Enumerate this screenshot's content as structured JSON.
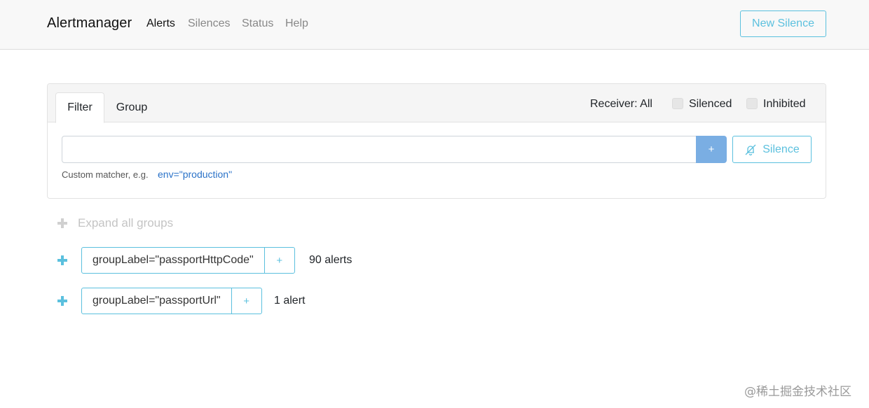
{
  "navbar": {
    "brand": "Alertmanager",
    "links": [
      "Alerts",
      "Silences",
      "Status",
      "Help"
    ],
    "new_silence_label": "New Silence"
  },
  "filter_card": {
    "tabs": [
      "Filter",
      "Group"
    ],
    "receiver_label": "Receiver: All",
    "silenced_label": "Silenced",
    "inhibited_label": "Inhibited",
    "filter_value": "",
    "add_label": "+",
    "silence_button_label": "Silence",
    "hint_text": "Custom matcher, e.g.",
    "hint_example": "env=\"production\""
  },
  "groups": {
    "expand_all_label": "Expand all groups",
    "items": [
      {
        "label": "groupLabel=\"passportHttpCode\"",
        "add": "+",
        "count": "90 alerts"
      },
      {
        "label": "groupLabel=\"passportUrl\"",
        "add": "+",
        "count": "1 alert"
      }
    ]
  },
  "watermark": "@稀土掘金技术社区",
  "colors": {
    "accent": "#5bc0de",
    "primary": "#7aaee3",
    "link": "#2a72c8"
  }
}
